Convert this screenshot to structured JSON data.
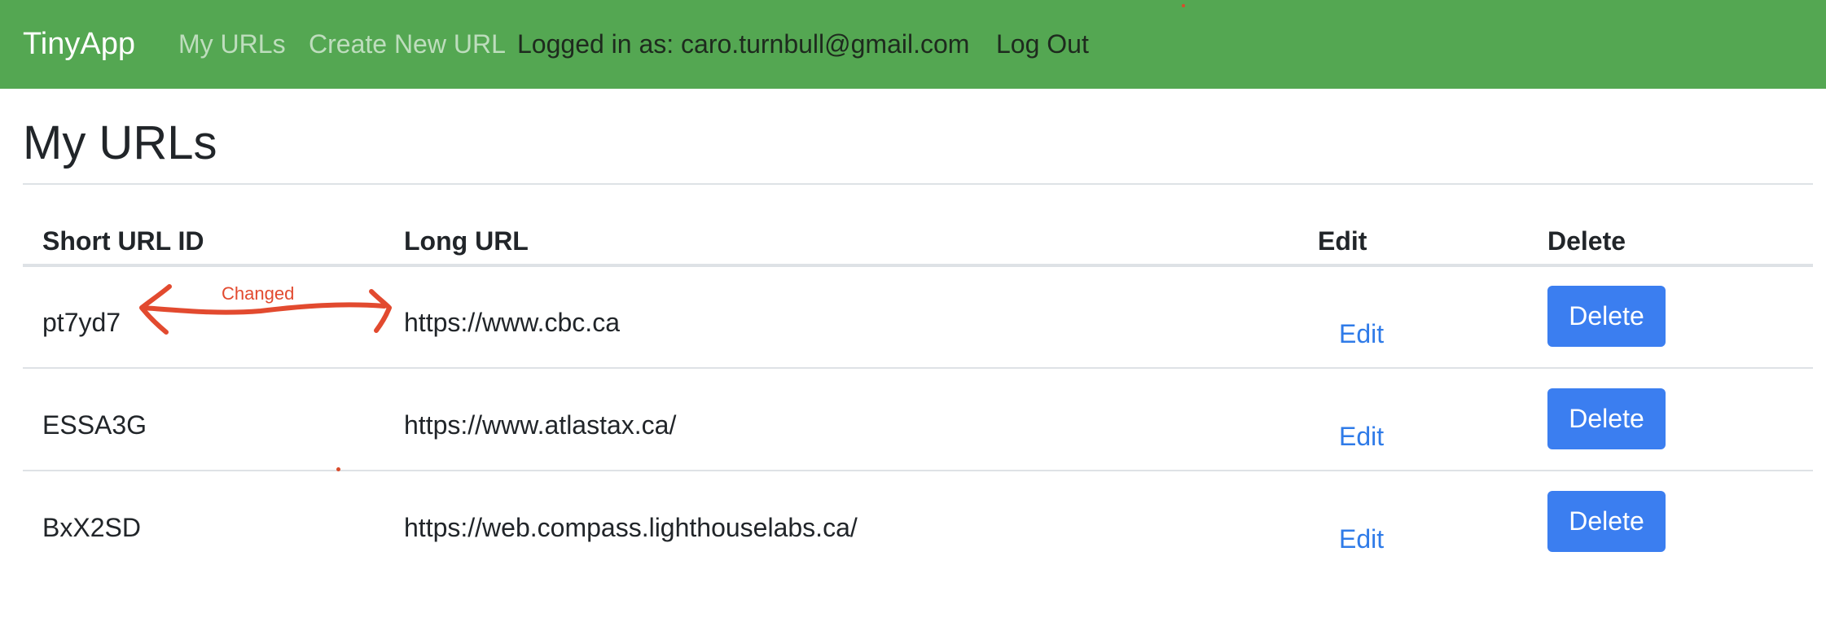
{
  "navbar": {
    "brand": "TinyApp",
    "links": [
      "My URLs",
      "Create New URL"
    ],
    "logged_in_text": "Logged in as: caro.turnbull@gmail.com",
    "logout_label": "Log Out",
    "color": "#54a752"
  },
  "page": {
    "title": "My URLs"
  },
  "table": {
    "headers": [
      "Short URL ID",
      "Long URL",
      "Edit",
      "Delete"
    ],
    "rows": [
      {
        "short_id": "pt7yd7",
        "long_url": "https://www.cbc.ca",
        "edit_label": "Edit",
        "delete_label": "Delete"
      },
      {
        "short_id": "ESSA3G",
        "long_url": "https://www.atlastax.ca/",
        "edit_label": "Edit",
        "delete_label": "Delete"
      },
      {
        "short_id": "BxX2SD",
        "long_url": "https://web.compass.lighthouselabs.ca/",
        "edit_label": "Edit",
        "delete_label": "Delete"
      }
    ]
  },
  "annotation": {
    "label": "Changed",
    "color": "#e24a2f",
    "icon": "double-headed-arrow-icon"
  },
  "colors": {
    "link": "#2f7be8",
    "button": "#3b7ef0"
  }
}
